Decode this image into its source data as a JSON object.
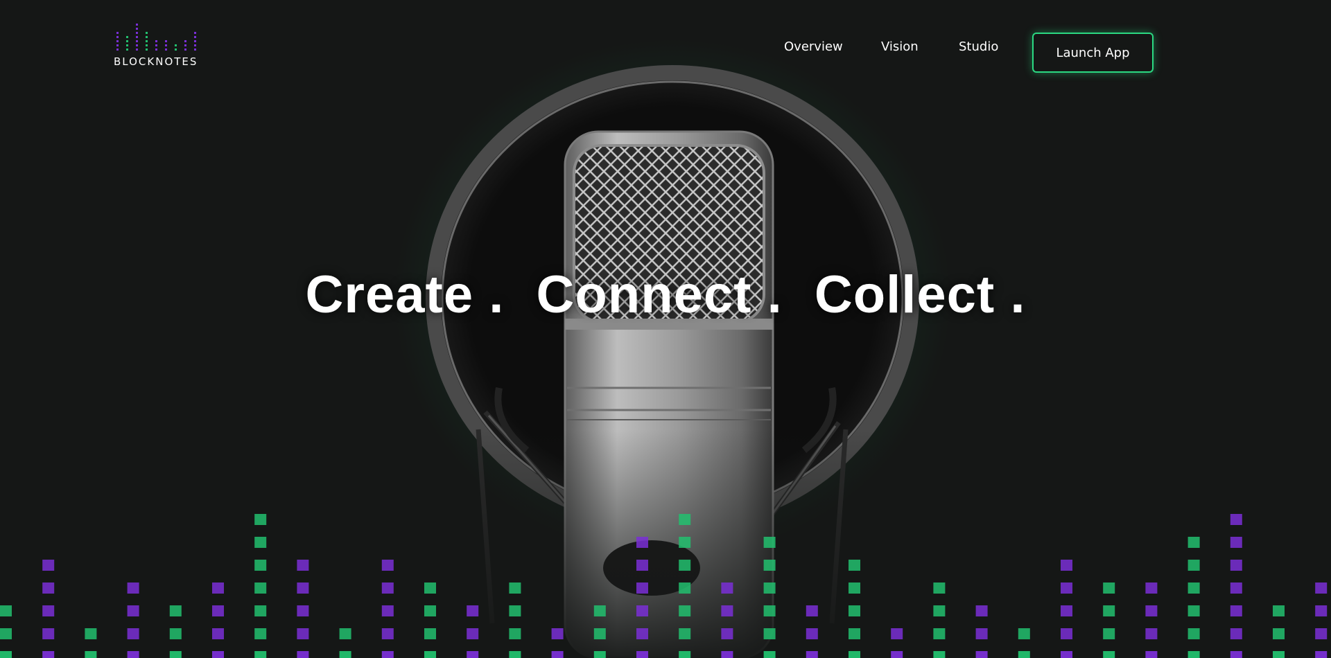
{
  "brand": {
    "name": "BLOCKNOTES",
    "accent_green": "#22c06e",
    "accent_purple": "#7a2fd6"
  },
  "nav": {
    "items": [
      {
        "label": "Overview"
      },
      {
        "label": "Vision"
      },
      {
        "label": "Studio"
      }
    ],
    "cta_label": "Launch App"
  },
  "hero": {
    "words": [
      "Create .",
      "Connect .",
      "Collect ."
    ],
    "image": "studio-condenser-microphone"
  }
}
